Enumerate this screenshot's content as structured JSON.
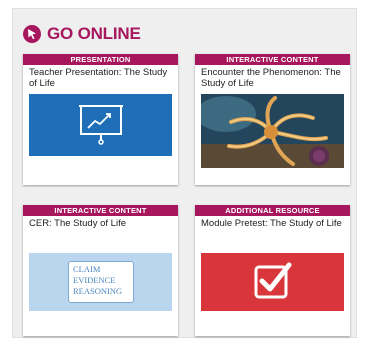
{
  "header": {
    "title": "GO ONLINE",
    "icon": "cursor-click-icon"
  },
  "colors": {
    "accent": "#a6175e",
    "blue_thumb": "#1f6fb8",
    "red_thumb": "#d9363c",
    "sky_thumb": "#b9d6ee"
  },
  "cards": [
    {
      "tag": "PRESENTATION",
      "title": "Teacher Presentation: The Study of Life",
      "thumb_icon": "presentation-chart-icon"
    },
    {
      "tag": "INTERACTIVE CONTENT",
      "title": "Encounter the Phenomenon: The Study of Life",
      "thumb_icon": "sea-creature-photo"
    },
    {
      "tag": "INTERACTIVE CONTENT",
      "title": "CER: The Study of Life",
      "thumb_lines": [
        "CLAIM",
        "EVIDENCE",
        "REASONING"
      ]
    },
    {
      "tag": "ADDITIONAL RESOURCE",
      "title": "Module Pretest: The Study of Life",
      "thumb_icon": "checkbox-icon"
    }
  ]
}
